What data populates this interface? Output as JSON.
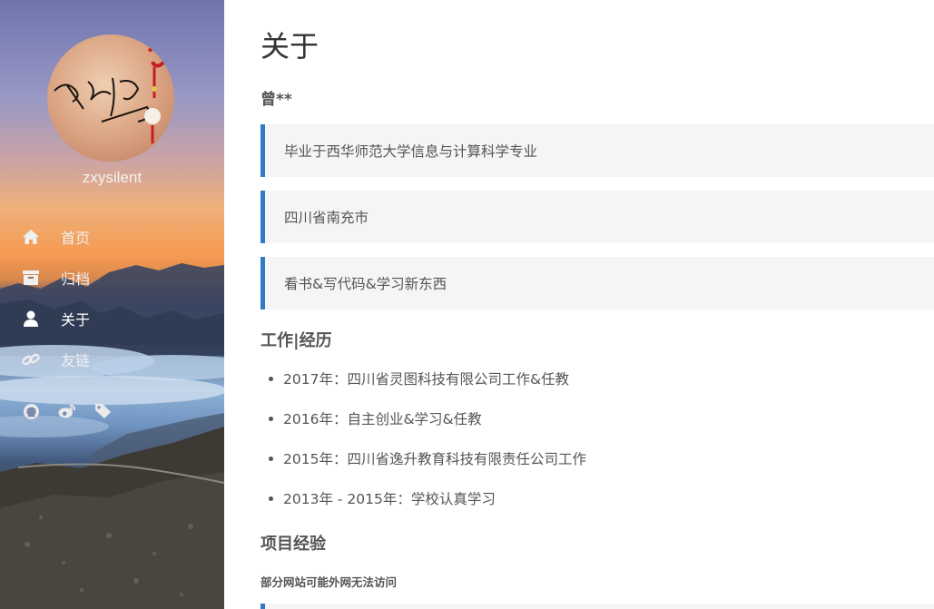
{
  "sidebar": {
    "username": "zxysilent",
    "avatar_signature": "曾祥银",
    "nav": [
      {
        "label": "首页",
        "icon": "home-icon",
        "active": false
      },
      {
        "label": "归档",
        "icon": "archive-icon",
        "active": false
      },
      {
        "label": "关于",
        "icon": "user-icon",
        "active": true
      },
      {
        "label": "友链",
        "icon": "link-icon",
        "active": false
      }
    ],
    "social": [
      "github-icon",
      "weibo-icon",
      "tags-icon"
    ]
  },
  "main": {
    "title": "关于",
    "name": "曾**",
    "quotes": [
      "毕业于西华师范大学信息与计算科学专业",
      "四川省南充市",
      "看书&写代码&学习新东西"
    ],
    "work_title": "工作|经历",
    "work": [
      "2017年：四川省灵图科技有限公司工作&任教",
      "2016年：自主创业&学习&任教",
      "2015年：四川省逸升教育科技有限责任公司工作",
      "2013年 - 2015年：学校认真学习"
    ],
    "project_title": "项目经验",
    "project_note": "部分网站可能外网无法访问"
  },
  "colors": {
    "accent": "#2f7bc8",
    "quote_bg": "#f5f5f5",
    "text": "#555555"
  }
}
